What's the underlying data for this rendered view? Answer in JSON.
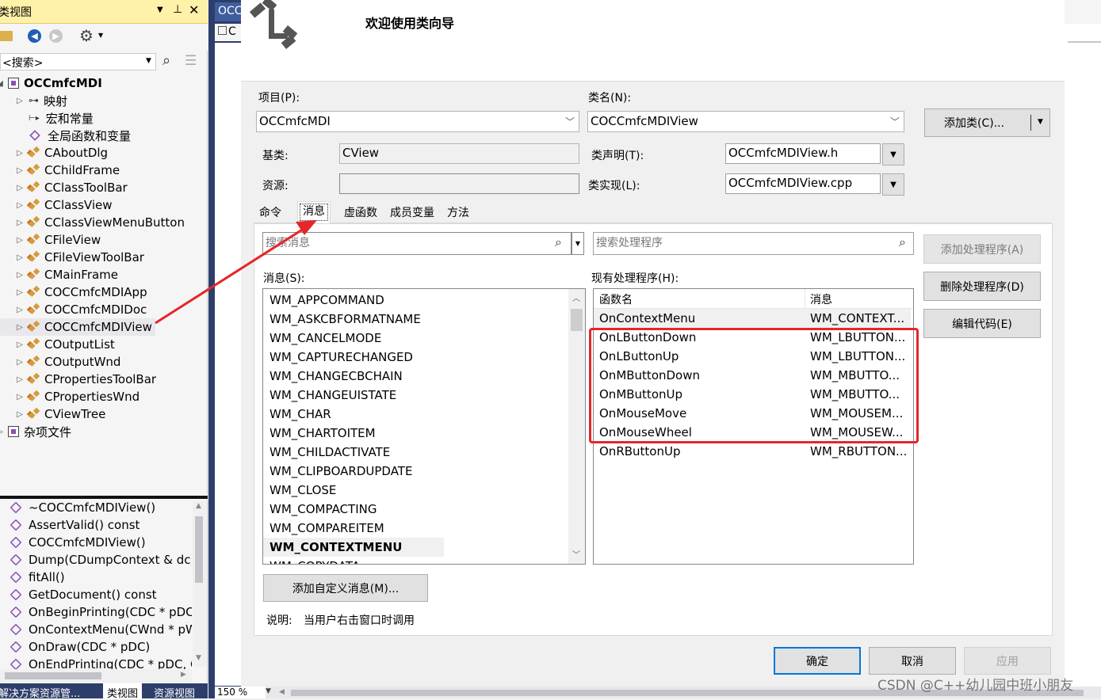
{
  "class_view": {
    "title": "类视图",
    "search_placeholder": "<搜索>",
    "tree": [
      {
        "label": "OCCmfcMDI",
        "level": 0,
        "kind": "project",
        "bold": true
      },
      {
        "label": "映射",
        "level": 1,
        "kind": "map"
      },
      {
        "label": "宏和常量",
        "level": 1,
        "kind": "macro"
      },
      {
        "label": "全局函数和变量",
        "level": 1,
        "kind": "global"
      },
      {
        "label": "CAboutDlg",
        "level": 1,
        "kind": "class"
      },
      {
        "label": "CChildFrame",
        "level": 1,
        "kind": "class"
      },
      {
        "label": "CClassToolBar",
        "level": 1,
        "kind": "class"
      },
      {
        "label": "CClassView",
        "level": 1,
        "kind": "class"
      },
      {
        "label": "CClassViewMenuButton",
        "level": 1,
        "kind": "class"
      },
      {
        "label": "CFileView",
        "level": 1,
        "kind": "class"
      },
      {
        "label": "CFileViewToolBar",
        "level": 1,
        "kind": "class"
      },
      {
        "label": "CMainFrame",
        "level": 1,
        "kind": "class"
      },
      {
        "label": "COCCmfcMDIApp",
        "level": 1,
        "kind": "class"
      },
      {
        "label": "COCCmfcMDIDoc",
        "level": 1,
        "kind": "class"
      },
      {
        "label": "COCCmfcMDIView",
        "level": 1,
        "kind": "class",
        "selected": true
      },
      {
        "label": "COutputList",
        "level": 1,
        "kind": "class"
      },
      {
        "label": "COutputWnd",
        "level": 1,
        "kind": "class"
      },
      {
        "label": "CPropertiesToolBar",
        "level": 1,
        "kind": "class"
      },
      {
        "label": "CPropertiesWnd",
        "level": 1,
        "kind": "class"
      },
      {
        "label": "CViewTree",
        "level": 1,
        "kind": "class"
      },
      {
        "label": "杂项文件",
        "level": 0,
        "kind": "project"
      }
    ],
    "members": [
      "~COCCmfcMDIView()",
      "AssertValid() const",
      "COCCmfcMDIView()",
      "Dump(CDumpContext & dc)",
      "fitAll()",
      "GetDocument() const",
      "OnBeginPrinting(CDC * pDC,",
      "OnContextMenu(CWnd * pW",
      "OnDraw(CDC * pDC)",
      "OnEndPrinting(CDC * pDC, C"
    ],
    "bottom_tabs": [
      "解决方案资源管...",
      "类视图",
      "资源视图"
    ]
  },
  "editor": {
    "tab_label": "OCC",
    "tab2_label": "C",
    "zoom": "150 %"
  },
  "wizard": {
    "title": "欢迎使用类向导",
    "project_label": "项目(P):",
    "project_value": "OCCmfcMDI",
    "classname_label": "类名(N):",
    "classname_value": "COCCmfcMDIView",
    "add_class_button": "添加类(C)...",
    "base_label": "基类:",
    "base_value": "CView",
    "decl_label": "类声明(T):",
    "decl_value": "OCCmfcMDIView.h",
    "resource_label": "资源:",
    "resource_value": "",
    "impl_label": "类实现(L):",
    "impl_value": "OCCmfcMDIView.cpp",
    "tabs": [
      "命令",
      "消息",
      "虚函数",
      "成员变量",
      "方法"
    ],
    "active_tab": "消息",
    "search_messages_placeholder": "搜索消息",
    "search_handlers_placeholder": "搜索处理程序",
    "messages_label": "消息(S):",
    "messages": [
      "WM_APPCOMMAND",
      "WM_ASKCBFORMATNAME",
      "WM_CANCELMODE",
      "WM_CAPTURECHANGED",
      "WM_CHANGECBCHAIN",
      "WM_CHANGEUISTATE",
      "WM_CHAR",
      "WM_CHARTOITEM",
      "WM_CHILDACTIVATE",
      "WM_CLIPBOARDUPDATE",
      "WM_CLOSE",
      "WM_COMPACTING",
      "WM_COMPAREITEM",
      "WM_CONTEXTMENU",
      "WM_COPYDATA"
    ],
    "selected_message": "WM_CONTEXTMENU",
    "handlers_label": "现有处理程序(H):",
    "handlers_columns": [
      "函数名",
      "消息"
    ],
    "handlers": [
      [
        "OnContextMenu",
        "WM_CONTEXT..."
      ],
      [
        "OnLButtonDown",
        "WM_LBUTTON..."
      ],
      [
        "OnLButtonUp",
        "WM_LBUTTON..."
      ],
      [
        "OnMButtonDown",
        "WM_MBUTTO..."
      ],
      [
        "OnMButtonUp",
        "WM_MBUTTO..."
      ],
      [
        "OnMouseMove",
        "WM_MOUSEM..."
      ],
      [
        "OnMouseWheel",
        "WM_MOUSEW..."
      ],
      [
        "OnRButtonUp",
        "WM_RBUTTON..."
      ]
    ],
    "add_handler_button": "添加处理程序(A)",
    "delete_handler_button": "删除处理程序(D)",
    "edit_code_button": "编辑代码(E)",
    "add_custom_message_button": "添加自定义消息(M)...",
    "description_label": "说明:",
    "description_value": "当用户右击窗口时调用",
    "ok_button": "确定",
    "cancel_button": "取消",
    "apply_button": "应用"
  },
  "watermark": "CSDN @C++幼儿园中班小朋友",
  "colors": {
    "highlight_box": "#e5262a",
    "arrow": "#e5262a",
    "vs_blue": "#2d3e6b",
    "selection": "#e8e8ec"
  }
}
